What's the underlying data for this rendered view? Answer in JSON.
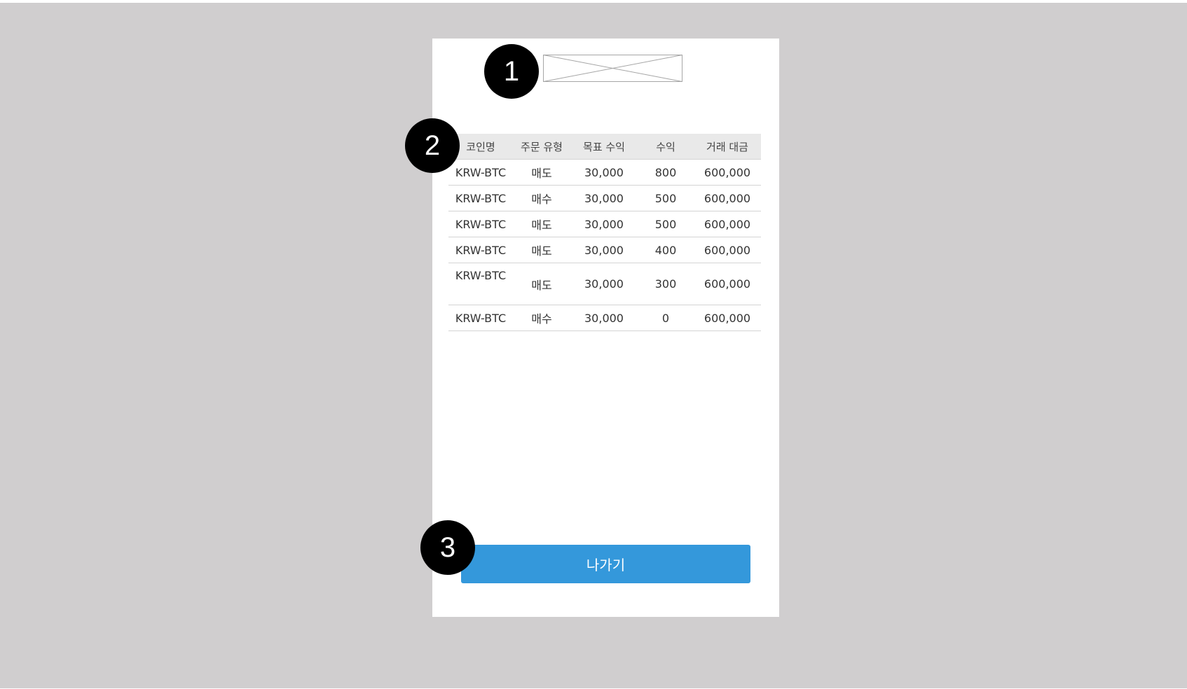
{
  "markers": [
    "1",
    "2",
    "3"
  ],
  "logo": {
    "icon": "image-placeholder-icon"
  },
  "table": {
    "headers": [
      "코인명",
      "주문 유형",
      "목표 수익",
      "수익",
      "거래 대금"
    ],
    "rows": [
      [
        "KRW-BTC",
        "매도",
        "30,000",
        "800",
        "600,000"
      ],
      [
        "KRW-BTC",
        "매수",
        "30,000",
        "500",
        "600,000"
      ],
      [
        "KRW-BTC",
        "매도",
        "30,000",
        "500",
        "600,000"
      ],
      [
        "KRW-BTC",
        "매도",
        "30,000",
        "400",
        "600,000"
      ],
      [
        "KRW-BTC",
        "매도",
        "30,000",
        "300",
        "600,000"
      ],
      [
        "KRW-BTC",
        "매수",
        "30,000",
        "0",
        "600,000"
      ]
    ]
  },
  "exit_button": {
    "label": "나가기"
  },
  "colors": {
    "backdrop": "#d0cecf",
    "button": "#3498db",
    "header_bg": "#e9e9e9"
  }
}
